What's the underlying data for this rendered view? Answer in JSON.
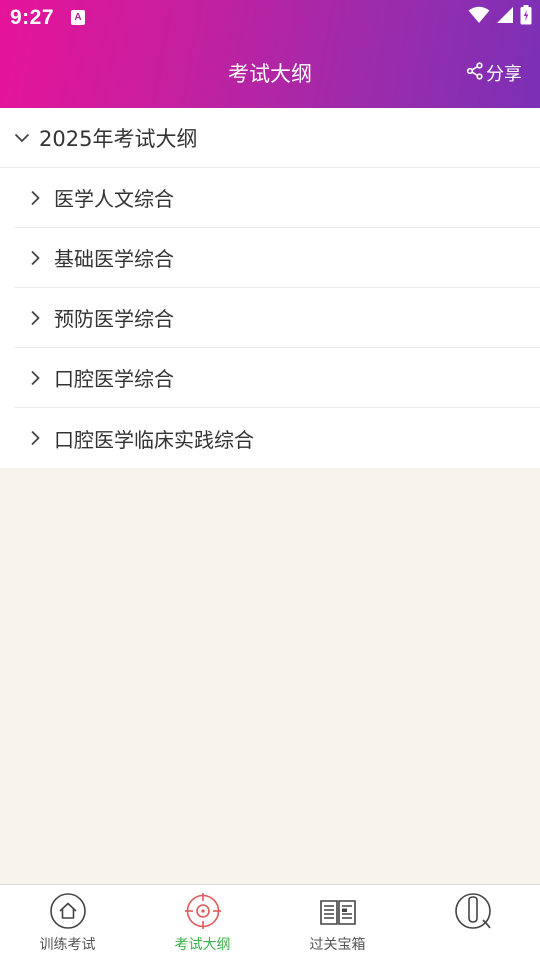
{
  "status_bar": {
    "time": "9:27",
    "app_icon_letter": "A"
  },
  "header": {
    "title": "考试大纲",
    "share_label": "分享"
  },
  "outline": {
    "group_label": "2025年考试大纲",
    "items": [
      {
        "label": "医学人文综合"
      },
      {
        "label": "基础医学综合"
      },
      {
        "label": "预防医学综合"
      },
      {
        "label": "口腔医学综合"
      },
      {
        "label": "口腔医学临床实践综合"
      }
    ]
  },
  "bottom_nav": {
    "items": [
      {
        "label": "训练考试",
        "icon": "home-icon"
      },
      {
        "label": "考试大纲",
        "icon": "target-icon",
        "active": true
      },
      {
        "label": "过关宝箱",
        "icon": "book-icon"
      },
      {
        "label": "",
        "icon": "profile-icon"
      }
    ]
  },
  "colors": {
    "header_start": "#e6139a",
    "header_end": "#7b30b6",
    "active_tab": "#3cb24a",
    "target_icon": "#e25a5a"
  }
}
